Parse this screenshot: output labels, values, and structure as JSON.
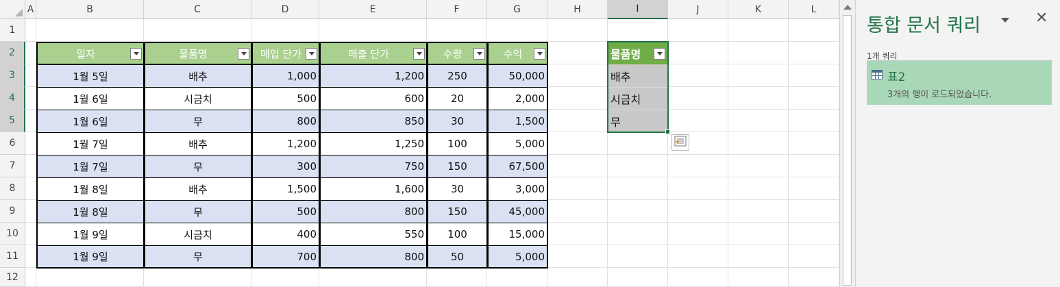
{
  "sheet": {
    "columns": [
      "A",
      "B",
      "C",
      "D",
      "E",
      "F",
      "G",
      "H",
      "I",
      "J",
      "K",
      "L"
    ],
    "rows": [
      "1",
      "2",
      "3",
      "4",
      "5",
      "6",
      "7",
      "8",
      "9",
      "10",
      "11",
      "12"
    ],
    "selected_column": "I",
    "selected_rows": [
      "2",
      "3",
      "4",
      "5"
    ]
  },
  "table": {
    "headers": [
      "일자",
      "물품명",
      "매입 단가",
      "매출 단가",
      "수량",
      "수익"
    ],
    "rows": [
      [
        "1월 5일",
        "배추",
        "1,000",
        "1,200",
        "250",
        "50,000"
      ],
      [
        "1월 6일",
        "시금치",
        "500",
        "600",
        "20",
        "2,000"
      ],
      [
        "1월 6일",
        "무",
        "800",
        "850",
        "30",
        "1,500"
      ],
      [
        "1월 7일",
        "배추",
        "1,200",
        "1,250",
        "100",
        "5,000"
      ],
      [
        "1월 7일",
        "무",
        "300",
        "750",
        "150",
        "67,500"
      ],
      [
        "1월 8일",
        "배추",
        "1,500",
        "1,600",
        "30",
        "3,000"
      ],
      [
        "1월 8일",
        "무",
        "500",
        "800",
        "150",
        "45,000"
      ],
      [
        "1월 9일",
        "시금치",
        "400",
        "550",
        "100",
        "15,000"
      ],
      [
        "1월 9일",
        "무",
        "700",
        "800",
        "50",
        "5,000"
      ]
    ]
  },
  "query_result": {
    "header": "물품명",
    "items": [
      "배추",
      "시금치",
      "무"
    ]
  },
  "pane": {
    "title": "통합 문서 쿼리",
    "close_glyph": "✕",
    "query_count": "1개 쿼리",
    "query_name": "표2",
    "query_status": "3개의 행이 로드되었습니다."
  },
  "colors": {
    "accent": "#217346",
    "header_green": "#a9d08e",
    "band_blue": "#d9e1f2",
    "query_header": "#70ad47",
    "query_body": "#c9c9c9",
    "query_card": "#a9d8b8"
  }
}
